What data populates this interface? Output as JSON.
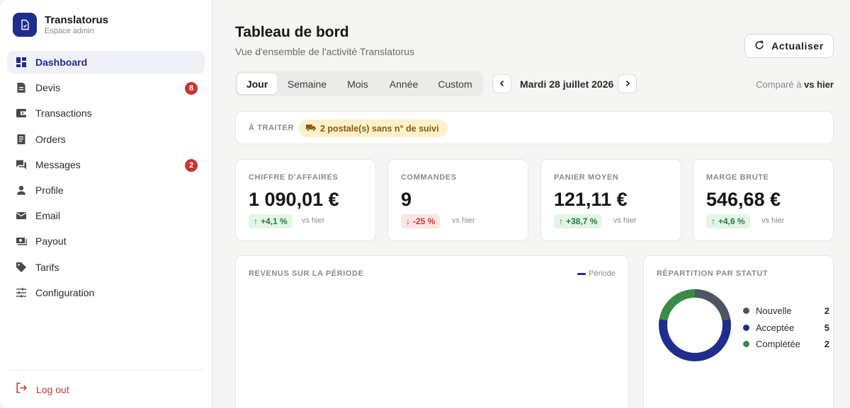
{
  "brand": {
    "name": "Translatorus",
    "subtitle": "Espace admin"
  },
  "sidebar": {
    "items": [
      {
        "label": "Dashboard",
        "icon": "dashboard-icon"
      },
      {
        "label": "Devis",
        "icon": "document-icon",
        "badge": "8"
      },
      {
        "label": "Transactions",
        "icon": "wallet-icon"
      },
      {
        "label": "Orders",
        "icon": "receipt-icon"
      },
      {
        "label": "Messages",
        "icon": "chat-icon",
        "badge": "2"
      },
      {
        "label": "Profile",
        "icon": "user-icon"
      },
      {
        "label": "Email",
        "icon": "mail-icon"
      },
      {
        "label": "Payout",
        "icon": "payout-icon"
      },
      {
        "label": "Tarifs",
        "icon": "tag-icon"
      },
      {
        "label": "Configuration",
        "icon": "sliders-icon"
      }
    ],
    "logout": "Log out"
  },
  "header": {
    "title": "Tableau de bord",
    "subtitle": "Vue d'ensemble de l'activité Translatorus",
    "refresh": "Actualiser"
  },
  "period": {
    "tabs": [
      "Jour",
      "Semaine",
      "Mois",
      "Année",
      "Custom"
    ],
    "active": "Jour",
    "date": "Mardi 28 juillet 2026",
    "compare_prefix": "Comparé à",
    "compare_value": "vs hier"
  },
  "todo": {
    "label": "À TRAITER",
    "pill": "2 postale(s) sans n° de suivi"
  },
  "kpis": [
    {
      "title": "CHIFFRE D'AFFAIRES",
      "value": "1 090,01 €",
      "delta": "+4,1 %",
      "direction": "up",
      "vs": "vs hier"
    },
    {
      "title": "COMMANDES",
      "value": "9",
      "delta": "-25 %",
      "direction": "down",
      "vs": "vs hier"
    },
    {
      "title": "PANIER MOYEN",
      "value": "121,11 €",
      "delta": "+38,7 %",
      "direction": "up",
      "vs": "vs hier"
    },
    {
      "title": "MARGE BRUTE",
      "value": "546,68 €",
      "delta": "+4,6 %",
      "direction": "up",
      "vs": "vs hier"
    }
  ],
  "revenue": {
    "title": "REVENUS SUR LA PÉRIODE",
    "legend": "Période"
  },
  "status": {
    "title": "RÉPARTITION PAR STATUT",
    "items": [
      {
        "label": "Nouvelle",
        "count": "2",
        "value": 2,
        "color": "#4b5563"
      },
      {
        "label": "Acceptée",
        "count": "5",
        "value": 5,
        "color": "#1f2d8f"
      },
      {
        "label": "Complétée",
        "count": "2",
        "value": 2,
        "color": "#3a8a4a"
      }
    ]
  },
  "colors": {
    "accent": "#1f2d8f",
    "danger": "#c8362f",
    "success": "#2b7a3c",
    "warning_bg": "#fdf1cc"
  }
}
